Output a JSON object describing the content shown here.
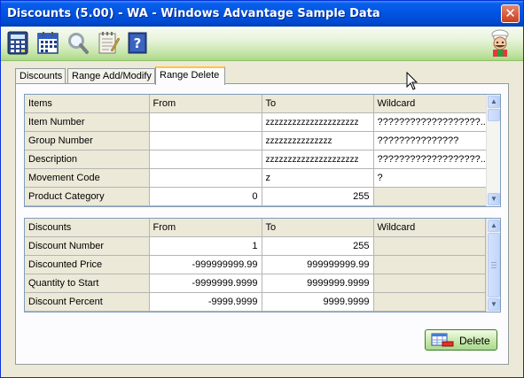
{
  "window": {
    "title": "Discounts (5.00) - WA - Windows Advantage Sample Data",
    "close_glyph": "✕"
  },
  "toolbar": {
    "buttons": [
      {
        "icon": "calculator-icon"
      },
      {
        "icon": "calendar-icon"
      },
      {
        "icon": "magnifier-icon"
      },
      {
        "icon": "notepad-icon"
      },
      {
        "icon": "help-book-icon"
      }
    ],
    "mascot_icon": "chef-mascot-icon"
  },
  "tabs": [
    {
      "label": "Discounts",
      "active": false
    },
    {
      "label": "Range Add/Modify",
      "active": false
    },
    {
      "label": "Range Delete",
      "active": true
    }
  ],
  "items_grid": {
    "headers": [
      "Items",
      "From",
      "To",
      "Wildcard"
    ],
    "rows": [
      {
        "label": "Item Number",
        "from": "",
        "to": "zzzzzzzzzzzzzzzzzzzzz",
        "wildcard": "???????????????????..."
      },
      {
        "label": "Group Number",
        "from": "",
        "to": "zzzzzzzzzzzzzzz",
        "wildcard": "???????????????"
      },
      {
        "label": "Description",
        "from": "",
        "to": "zzzzzzzzzzzzzzzzzzzzz",
        "wildcard": "???????????????????..."
      },
      {
        "label": "Movement Code",
        "from": "",
        "to": "z",
        "wildcard": "?"
      },
      {
        "label": "Product Category",
        "from": "0",
        "to": "255",
        "wildcard": ""
      }
    ]
  },
  "discounts_grid": {
    "headers": [
      "Discounts",
      "From",
      "To",
      "Wildcard"
    ],
    "rows": [
      {
        "label": "Discount Number",
        "from": "1",
        "to": "255",
        "wildcard": ""
      },
      {
        "label": "Discounted Price",
        "from": "-999999999.99",
        "to": "999999999.99",
        "wildcard": ""
      },
      {
        "label": "Quantity to Start",
        "from": "-9999999.9999",
        "to": "9999999.9999",
        "wildcard": ""
      },
      {
        "label": "Discount Percent",
        "from": "-9999.9999",
        "to": "9999.9999",
        "wildcard": ""
      }
    ]
  },
  "delete_button": {
    "label": "Delete",
    "underline_char": "D"
  },
  "colors": {
    "titlebar": "#0054e3",
    "toolbar": "#c4e4a6",
    "active_tab_accent": "#ffc83c",
    "delete_button": "#a8d98a"
  }
}
